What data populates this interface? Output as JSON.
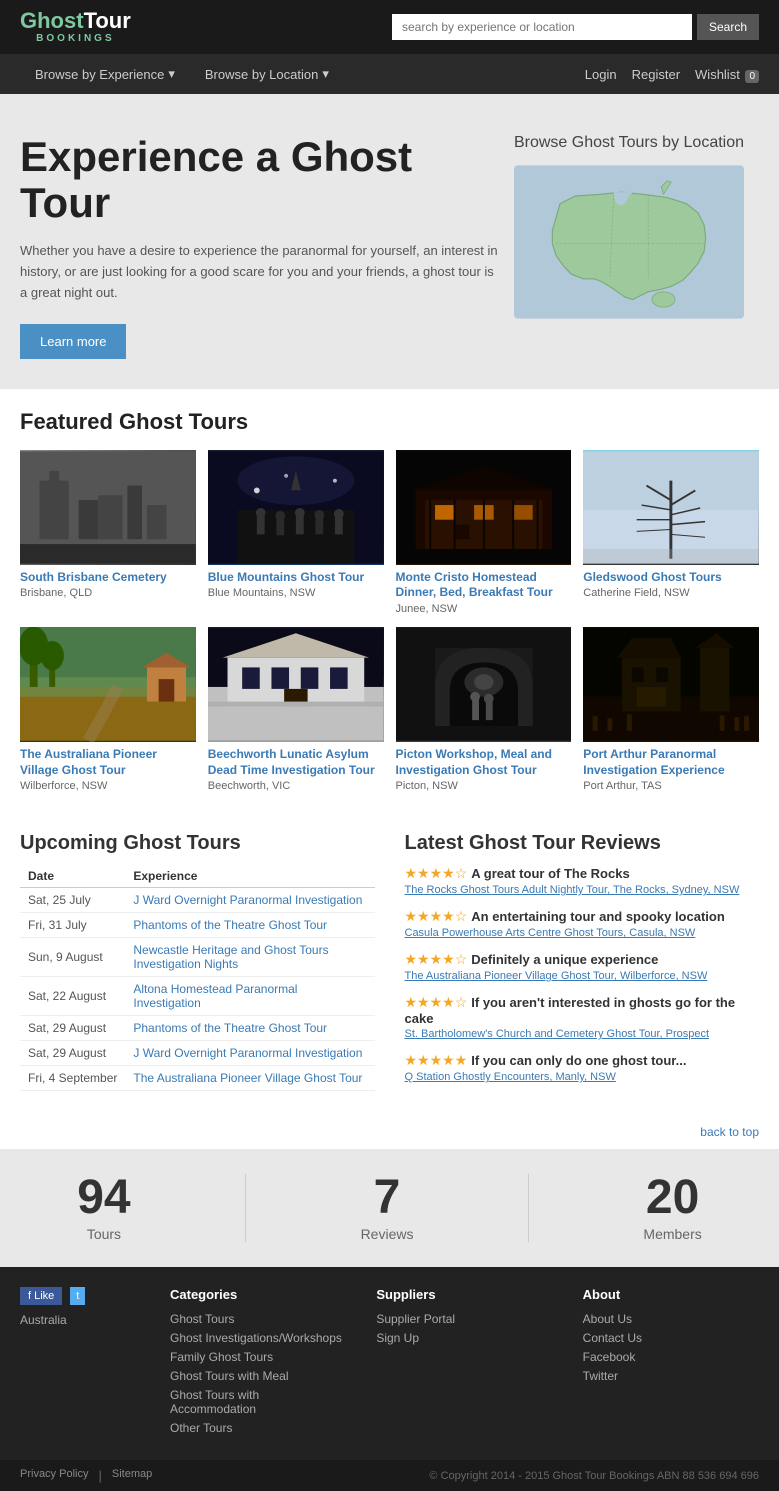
{
  "header": {
    "logo_ghost": "Ghost",
    "logo_tour": "Tour",
    "logo_bookings": "BOOKINGS",
    "search_placeholder": "search by experience or location",
    "search_button": "Search",
    "nav_experience": "Browse by Experience",
    "nav_location": "Browse by Location",
    "nav_login": "Login",
    "nav_register": "Register",
    "nav_wishlist": "Wishlist",
    "wishlist_count": "0"
  },
  "hero": {
    "title": "Experience a Ghost Tour",
    "description": "Whether you have a desire to experience the paranormal for yourself, an interest in history, or are just looking for a good scare for you and your friends, a ghost tour is a great night out.",
    "learn_more": "Learn more",
    "map_title": "Browse Ghost Tours by Location"
  },
  "featured": {
    "section_title": "Featured Ghost Tours",
    "tours": [
      {
        "name": "South Brisbane Cemetery",
        "location": "Brisbane, QLD"
      },
      {
        "name": "Blue Mountains Ghost Tour",
        "location": "Blue Mountains, NSW"
      },
      {
        "name": "Monte Cristo Homestead Dinner, Bed, Breakfast Tour",
        "location": "Junee, NSW"
      },
      {
        "name": "Gledswood Ghost Tours",
        "location": "Catherine Field, NSW"
      },
      {
        "name": "The Australiana Pioneer Village Ghost Tour",
        "location": "Wilberforce, NSW"
      },
      {
        "name": "Beechworth Lunatic Asylum Dead Time Investigation Tour",
        "location": "Beechworth, VIC"
      },
      {
        "name": "Picton Workshop, Meal and Investigation Ghost Tour",
        "location": "Picton, NSW"
      },
      {
        "name": "Port Arthur Paranormal Investigation Experience",
        "location": "Port Arthur, TAS"
      }
    ]
  },
  "upcoming": {
    "section_title": "Upcoming Ghost Tours",
    "col_date": "Date",
    "col_experience": "Experience",
    "tours": [
      {
        "date": "Sat, 25 July",
        "name": "J Ward Overnight Paranormal Investigation"
      },
      {
        "date": "Fri, 31 July",
        "name": "Phantoms of the Theatre Ghost Tour"
      },
      {
        "date": "Sun, 9 August",
        "name": "Newcastle Heritage and Ghost Tours Investigation Nights"
      },
      {
        "date": "Sat, 22 August",
        "name": "Altona Homestead Paranormal Investigation"
      },
      {
        "date": "Sat, 29 August",
        "name": "Phantoms of the Theatre Ghost Tour"
      },
      {
        "date": "Sat, 29 August",
        "name": "J Ward Overnight Paranormal Investigation"
      },
      {
        "date": "Fri, 4 September",
        "name": "The Australiana Pioneer Village Ghost Tour"
      }
    ]
  },
  "reviews": {
    "section_title": "Latest Ghost Tour Reviews",
    "items": [
      {
        "stars": 4,
        "text": "A great tour of The Rocks",
        "link": "The Rocks Ghost Tours Adult Nightly Tour, The Rocks, Sydney, NSW"
      },
      {
        "stars": 4,
        "text": "An entertaining tour and spooky location",
        "link": "Casula Powerhouse Arts Centre Ghost Tours, Casula, NSW"
      },
      {
        "stars": 4,
        "text": "Definitely a unique experience",
        "link": "The Australiana Pioneer Village Ghost Tour, Wilberforce, NSW"
      },
      {
        "stars": 4,
        "text": "If you aren't interested in ghosts go for the cake",
        "link": "St. Bartholomew's Church and Cemetery Ghost Tour, Prospect"
      },
      {
        "stars": 5,
        "text": "If you can only do one ghost tour...",
        "link": "Q Station Ghostly Encounters, Manly, NSW"
      }
    ]
  },
  "back_to_top": "back to top",
  "stats": [
    {
      "number": "94",
      "label": "Tours"
    },
    {
      "number": "7",
      "label": "Reviews"
    },
    {
      "number": "20",
      "label": "Members"
    }
  ],
  "footer": {
    "country": "Australia",
    "categories_title": "Categories",
    "categories": [
      "Ghost Tours",
      "Ghost Investigations/Workshops",
      "Family Ghost Tours",
      "Ghost Tours with Meal",
      "Ghost Tours with Accommodation",
      "Other Tours"
    ],
    "suppliers_title": "Suppliers",
    "suppliers": [
      "Supplier Portal",
      "Sign Up"
    ],
    "about_title": "About",
    "about_links": [
      "About Us",
      "Contact Us",
      "Facebook",
      "Twitter"
    ],
    "privacy": "Privacy Policy",
    "sitemap": "Sitemap",
    "copyright": "© Copyright 2014 - 2015 Ghost Tour Bookings ABN 88 536 694 696"
  }
}
